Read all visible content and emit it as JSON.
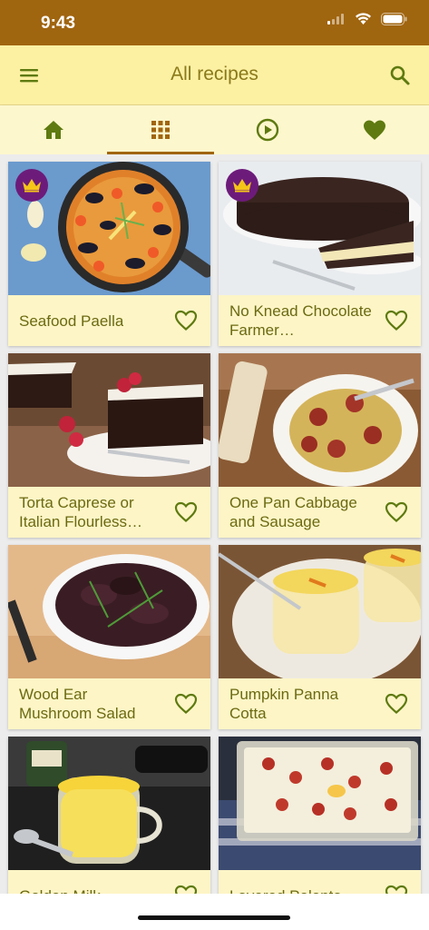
{
  "status_bar": {
    "time": "9:43"
  },
  "app_bar": {
    "title": "All recipes",
    "menu_icon": "hamburger-menu-icon",
    "search_icon": "search-icon"
  },
  "tabs": [
    {
      "icon": "home-icon",
      "selected": false
    },
    {
      "icon": "grid-icon",
      "selected": true
    },
    {
      "icon": "play-icon",
      "selected": false
    },
    {
      "icon": "heart-icon",
      "selected": false
    }
  ],
  "colors": {
    "status_bar": "#a0650f",
    "app_bar": "#fcf0a3",
    "tab_bar": "#fdf7cd",
    "card": "#fdf5c6",
    "accent_green": "#5e7a10",
    "crown_badge": "#6d1b7b",
    "title_text": "#8a7a1b"
  },
  "recipes": [
    {
      "title": "Seafood Paella",
      "premium": true
    },
    {
      "title": "No Knead Chocolate Farmer…",
      "premium": true
    },
    {
      "title": "Torta Caprese or Italian Flourless…",
      "premium": false
    },
    {
      "title": "One Pan Cabbage and Sausage",
      "premium": false
    },
    {
      "title": "Wood Ear Mushroom Salad",
      "premium": false
    },
    {
      "title": "Pumpkin Panna Cotta",
      "premium": false
    },
    {
      "title": "Golden Milk",
      "premium": false
    },
    {
      "title": "Layered Polenta",
      "premium": false
    }
  ]
}
